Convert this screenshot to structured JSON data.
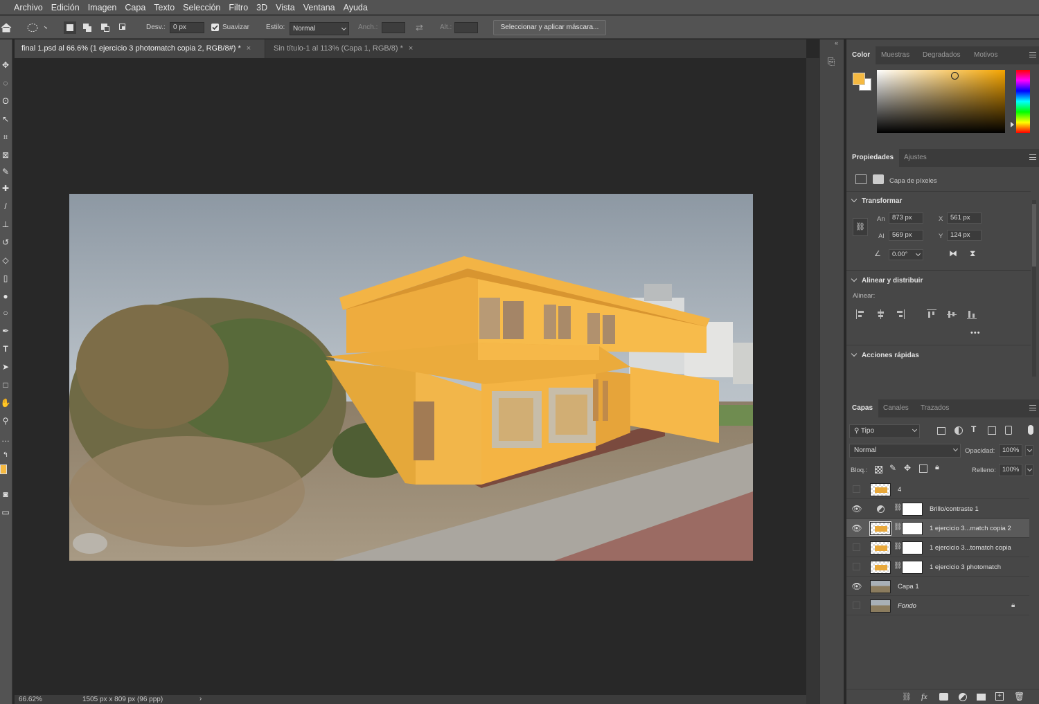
{
  "menu": [
    "Archivo",
    "Edición",
    "Imagen",
    "Capa",
    "Texto",
    "Selección",
    "Filtro",
    "3D",
    "Vista",
    "Ventana",
    "Ayuda"
  ],
  "options": {
    "feather_label": "Desv.:",
    "feather_value": "0 px",
    "antialias_label": "Suavizar",
    "style_label": "Estilo:",
    "style_value": "Normal",
    "width_label": "Anch.:",
    "height_label": "Alt.:",
    "mask_button": "Seleccionar y aplicar máscara..."
  },
  "tabs": [
    {
      "label": "final 1.psd al 66.6% (1 ejercicio 3 photomatch copia 2, RGB/8#) *",
      "close": "×"
    },
    {
      "label": "Sin título-1 al 113% (Capa 1, RGB/8) *",
      "close": "×"
    }
  ],
  "status": {
    "zoom": "66.62%",
    "doc": "1505 px x 809 px (96 ppp)",
    "arrow": "›"
  },
  "color_panel": {
    "tabs": [
      "Color",
      "Muestras",
      "Degradados",
      "Motivos"
    ],
    "foreground": "#f5b941",
    "background": "#ffffff"
  },
  "properties": {
    "tabs": [
      "Propiedades",
      "Ajustes"
    ],
    "kind": "Capa de píxeles",
    "transform_title": "Transformar",
    "w_label": "An",
    "w_value": "873 px",
    "h_label": "Al",
    "h_value": "569 px",
    "x_label": "X",
    "x_value": "561 px",
    "y_label": "Y",
    "y_value": "124 px",
    "angle_value": "0.00°",
    "align_title": "Alinear y distribuir",
    "align_label": "Alinear:",
    "more": "•••",
    "quick_title": "Acciones rápidas"
  },
  "layers_panel": {
    "tabs": [
      "Capas",
      "Canales",
      "Trazados"
    ],
    "filter": "Tipo",
    "blend": "Normal",
    "opacity_label": "Opacidad:",
    "opacity": "100%",
    "lock_label": "Bloq.:",
    "fill_label": "Relleno:",
    "fill": "100%",
    "layers": [
      {
        "name": "4",
        "visible": false,
        "type": "image",
        "mask": false,
        "selected": false
      },
      {
        "name": "Brillo/contraste 1",
        "visible": true,
        "type": "adjustment",
        "mask": true,
        "selected": false
      },
      {
        "name": "1 ejercicio 3...match copia 2",
        "visible": true,
        "type": "image",
        "mask": true,
        "selected": true
      },
      {
        "name": "1 ejercicio 3...tomatch copia",
        "visible": false,
        "type": "image",
        "mask": true,
        "selected": false
      },
      {
        "name": "1 ejercicio 3 photomatch",
        "visible": false,
        "type": "image",
        "mask": true,
        "selected": false
      },
      {
        "name": "Capa 1",
        "visible": true,
        "type": "photo",
        "mask": false,
        "selected": false
      },
      {
        "name": "Fondo",
        "visible": false,
        "type": "photo",
        "mask": false,
        "selected": false,
        "locked": true
      }
    ]
  }
}
